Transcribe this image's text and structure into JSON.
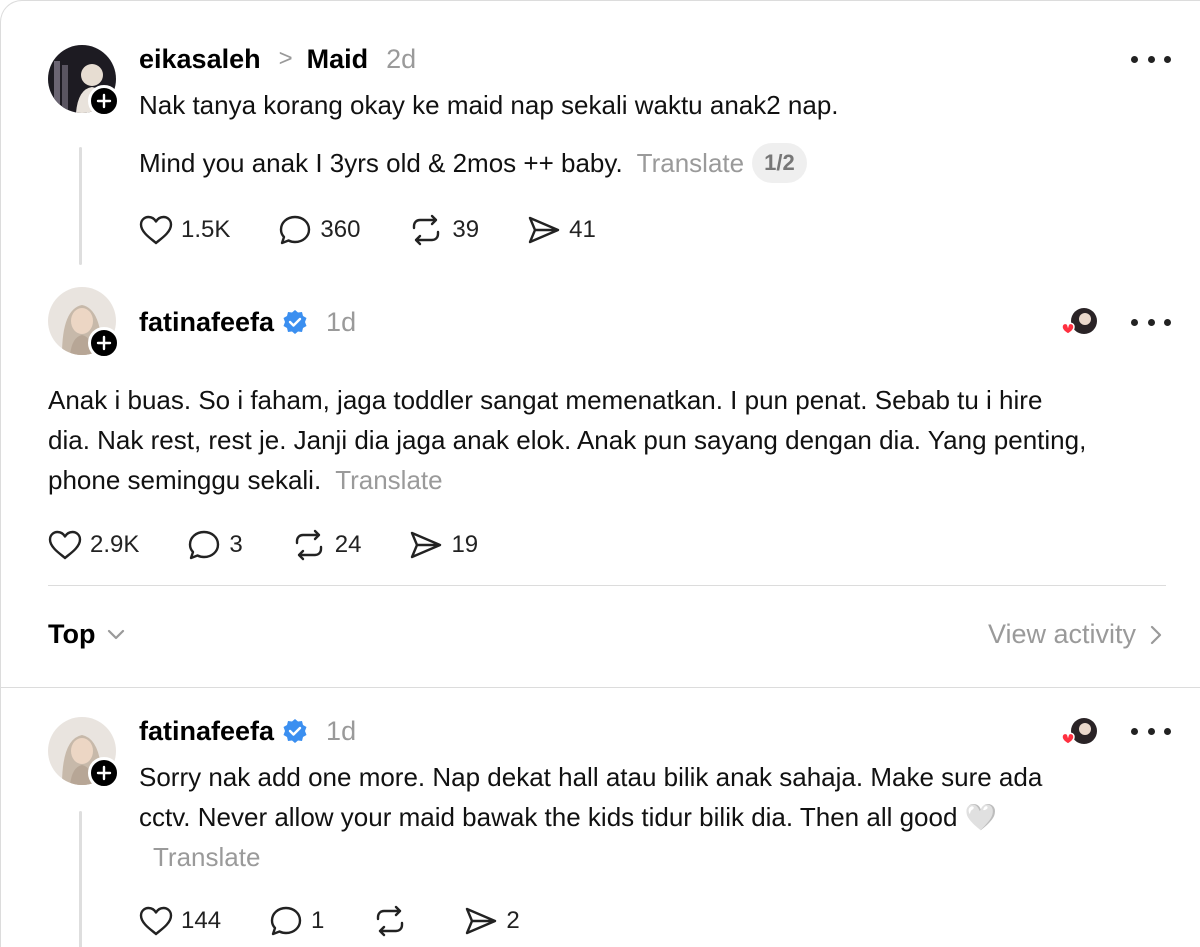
{
  "post1": {
    "username": "eikasaleh",
    "separator": ">",
    "topic": "Maid",
    "time": "2d",
    "line1": "Nak tanya korang okay ke maid nap sekali waktu anak2 nap.",
    "line2": "Mind you anak I 3yrs old & 2mos ++ baby.",
    "translate": "Translate",
    "pager": "1/2",
    "likes": "1.5K",
    "comments": "360",
    "reposts": "39",
    "shares": "41"
  },
  "post2": {
    "username": "fatinafeefa",
    "time": "1d",
    "text": "Anak i buas. So i faham, jaga toddler sangat memenatkan. I pun penat. Sebab tu i hire dia. Nak rest, rest je. Janji dia jaga anak elok. Anak pun sayang dengan dia. Yang penting, phone seminggu sekali.",
    "translate": "Translate",
    "likes": "2.9K",
    "comments": "3",
    "reposts": "24",
    "shares": "19"
  },
  "sort": {
    "label": "Top",
    "view_activity": "View activity"
  },
  "post3": {
    "username": "fatinafeefa",
    "time": "1d",
    "text": "Sorry nak add one more. Nap dekat hall atau bilik anak sahaja. Make sure ada cctv. Never allow your maid bawak the kids tidur bilik dia. Then all good",
    "emoji": "🤍",
    "translate": "Translate",
    "likes": "144",
    "comments": "1",
    "reposts": "",
    "shares": "2"
  },
  "colors": {
    "verified": "#3b8ff0",
    "muted": "#9a9a9a",
    "heart_red": "#ff3040"
  }
}
